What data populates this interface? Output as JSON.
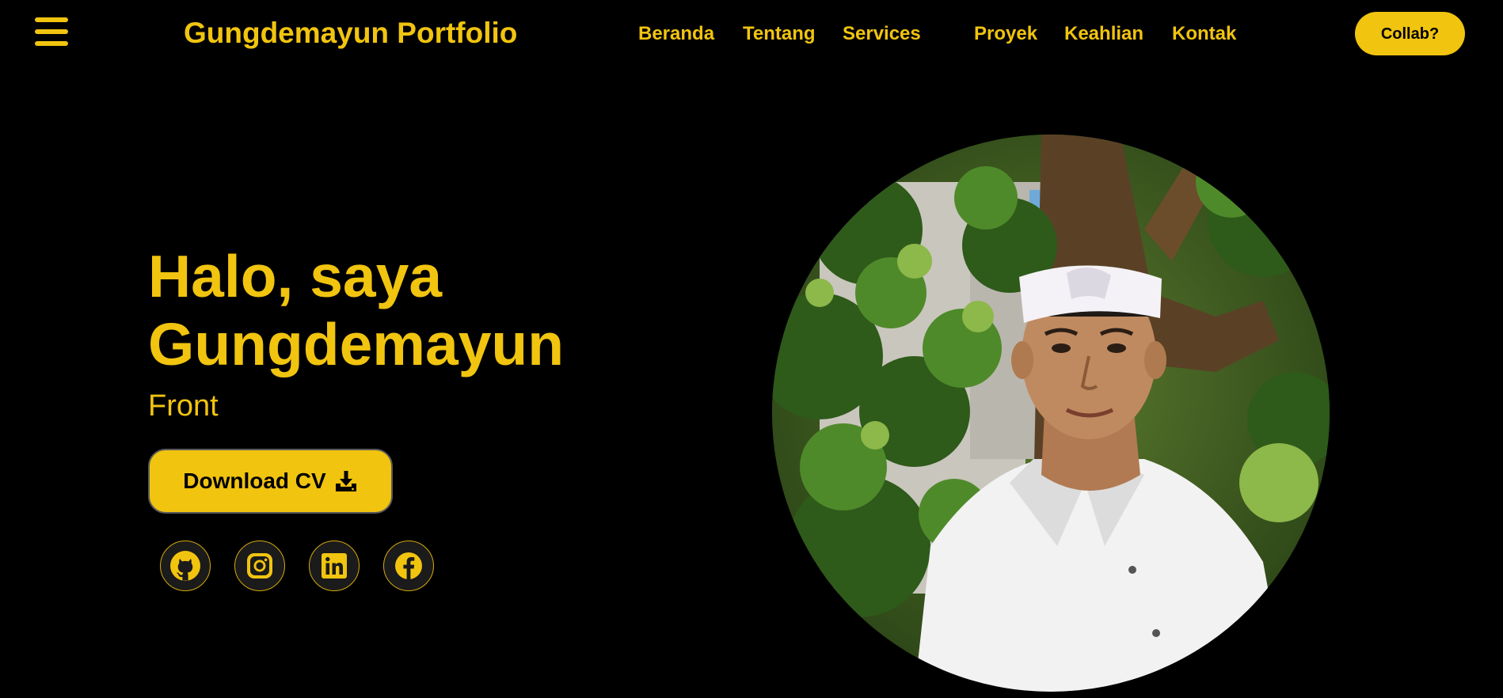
{
  "header": {
    "brand": "Gungdemayun Portfolio",
    "nav": [
      "Beranda",
      "Tentang",
      "Services",
      "Proyek",
      "Keahlian",
      "Kontak"
    ],
    "collab_label": "Collab?"
  },
  "hero": {
    "title_line1": "Halo, saya",
    "title_line2": "Gungdemayun",
    "subtitle": "Front",
    "cv_label": "Download CV"
  },
  "socials": [
    "github-icon",
    "instagram-icon",
    "linkedin-icon",
    "facebook-icon"
  ],
  "colors": {
    "background": "#000000",
    "accent": "#f1c40f",
    "button_text": "#000000"
  }
}
